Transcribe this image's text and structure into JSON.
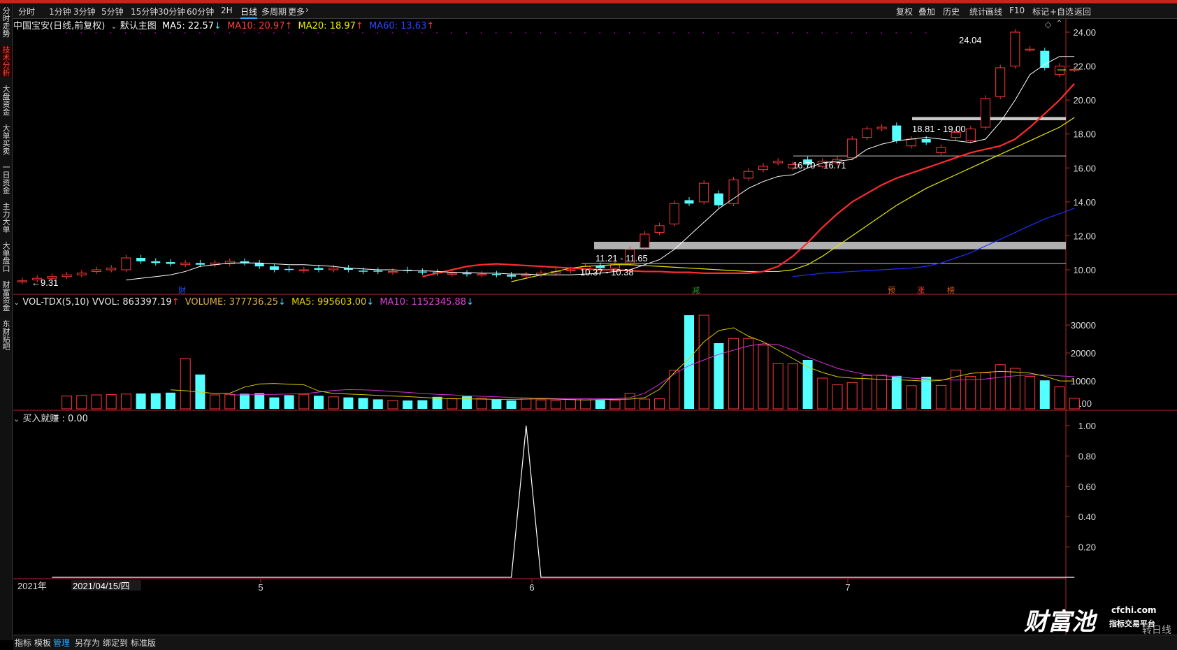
{
  "toolbar": {
    "left_items": [
      "分时",
      "1分钟",
      "3分钟",
      "5分钟",
      "15分钟",
      "30分钟",
      "60分钟",
      "2H",
      "日线",
      "多周期",
      "更多"
    ],
    "active": "日线",
    "right_items": [
      "复权",
      "叠加",
      "历史",
      "统计",
      "画线",
      "F10",
      "标记",
      "+自选",
      "返回"
    ]
  },
  "sidebar": {
    "items": [
      "分时走势",
      "技术分析",
      "大盘资金",
      "大单买卖",
      "一日资金",
      "主力大单",
      "大单盘口",
      "财富资金",
      "东财贴吧"
    ],
    "active": "技术分析"
  },
  "main": {
    "title": "中国宝安(日线,前复权)",
    "template": "默认主图",
    "ma5": "MA5: 22.57",
    "ma10": "MA10: 20.97",
    "ma20": "MA20: 18.97",
    "ma60": "MA60: 13.63",
    "colors": {
      "ma5": "#ffffff",
      "ma10": "#ff2b2b",
      "ma20": "#e6e600",
      "ma60": "#1a30ff"
    },
    "y_ticks": [
      "24.00",
      "22.00",
      "20.00",
      "18.00",
      "16.00",
      "14.00",
      "12.00",
      "10.00"
    ],
    "annotations": {
      "high": "24.04",
      "low": "9.31",
      "gap_a": "18.81 - 19.00",
      "gap_b": "16.70 - 16.71",
      "gap_c": "11.21 - 11.65",
      "gap_d": "10.37 - 10.38"
    },
    "markers": [
      "财",
      "减",
      "预",
      "涨",
      "榜"
    ]
  },
  "volume": {
    "title": "VOL-TDX(5,10)",
    "vvol": "VVOL: 863397.19",
    "volume": "VOLUME: 377736.25",
    "ma5": "MA5: 995603.00",
    "ma10": "MA10: 1152345.88",
    "y_ticks": [
      "30000",
      "20000",
      "10000"
    ],
    "unit": "X100"
  },
  "indicator": {
    "title": "买入就赚 : 0.00",
    "y_ticks": [
      "1.00",
      "0.80",
      "0.60",
      "0.40",
      "0.20"
    ]
  },
  "time_axis": {
    "year": "2021年",
    "cursor_date": "2021/04/15/四",
    "months": [
      "5",
      "6",
      "7"
    ]
  },
  "bottom_tabs": {
    "items": [
      "指标",
      "模板",
      "管理",
      "另存为",
      "绑定到",
      "标准版"
    ],
    "active": "管理"
  },
  "watermark": {
    "brand": "财富池",
    "site": "cfchi.com",
    "slogan": "指标交易平台",
    "right_text": "转日线"
  },
  "chart_data": [
    {
      "type": "candlestick",
      "title": "中国宝安(日线,前复权)",
      "note": "daily K-line from 2021-03 to 2021-08, prices in CNY",
      "ylim": [
        9.0,
        24.5
      ],
      "close": [
        9.35,
        9.5,
        9.6,
        9.7,
        9.8,
        10.0,
        10.1,
        10.7,
        10.5,
        10.4,
        10.35,
        10.4,
        10.3,
        10.4,
        10.5,
        10.4,
        10.2,
        10.0,
        10.0,
        10.0,
        10.0,
        10.1,
        10.0,
        9.9,
        9.9,
        9.9,
        9.95,
        9.85,
        9.8,
        9.8,
        9.75,
        9.75,
        9.7,
        9.6,
        9.7,
        9.8,
        9.9,
        10.0,
        10.2,
        10.1,
        10.3,
        11.2,
        12.1,
        12.6,
        13.9,
        13.9,
        15.1,
        13.8,
        15.3,
        15.8,
        16.1,
        16.4,
        16.2,
        16.2,
        16.4,
        16.5,
        17.7,
        18.3,
        18.4,
        17.6,
        17.7,
        17.5,
        17.2,
        18.1,
        18.3,
        20.1,
        21.9,
        24.0,
        23.0,
        21.9,
        22.0,
        21.8
      ],
      "open": [
        9.3,
        9.4,
        9.5,
        9.6,
        9.7,
        9.9,
        10.0,
        10.0,
        10.7,
        10.5,
        10.45,
        10.3,
        10.4,
        10.3,
        10.35,
        10.5,
        10.4,
        10.2,
        10.05,
        9.95,
        10.1,
        10.0,
        10.1,
        9.95,
        9.95,
        9.85,
        10.0,
        9.9,
        9.85,
        9.75,
        9.8,
        9.7,
        9.75,
        9.7,
        9.65,
        9.7,
        9.8,
        9.95,
        10.05,
        10.25,
        10.1,
        10.4,
        11.3,
        12.2,
        12.7,
        14.1,
        14.0,
        14.5,
        13.9,
        15.4,
        15.9,
        16.3,
        16.0,
        16.5,
        16.1,
        16.3,
        16.6,
        17.8,
        18.3,
        18.5,
        17.3,
        17.7,
        16.9,
        17.8,
        17.6,
        18.4,
        20.2,
        22.0,
        23.0,
        22.9,
        21.5,
        21.8
      ],
      "ma5": [
        9.4,
        9.5,
        9.6,
        9.7,
        9.9,
        10.2,
        10.3,
        10.4,
        10.4,
        10.4,
        10.35,
        10.3,
        10.3,
        10.25,
        10.2,
        10.1,
        10.05,
        10.0,
        10.0,
        9.95,
        9.95,
        9.9,
        9.85,
        9.85,
        9.8,
        9.8,
        9.75,
        9.75,
        9.7,
        9.7,
        9.7,
        9.75,
        9.8,
        9.9,
        10.0,
        10.3,
        10.6,
        11.2,
        12.0,
        12.8,
        13.6,
        14.2,
        14.8,
        15.2,
        15.5,
        15.6,
        16.0,
        16.3,
        16.4,
        16.5,
        17.1,
        17.4,
        17.6,
        17.7,
        17.8,
        17.7,
        17.6,
        17.5,
        17.7,
        18.7,
        20.0,
        21.5,
        22.1,
        22.57,
        22.57
      ],
      "ma10": [
        9.6,
        9.8,
        10.0,
        10.2,
        10.3,
        10.35,
        10.3,
        10.25,
        10.2,
        10.15,
        10.1,
        10.05,
        10.0,
        10.0,
        9.95,
        9.9,
        9.9,
        9.85,
        9.85,
        9.8,
        9.8,
        9.8,
        9.8,
        9.9,
        10.2,
        10.8,
        11.6,
        12.5,
        13.3,
        14.0,
        14.5,
        15.0,
        15.4,
        15.7,
        16.0,
        16.3,
        16.6,
        16.9,
        17.1,
        17.3,
        17.7,
        18.4,
        19.2,
        20.0,
        20.97
      ],
      "ma20": [
        9.3,
        9.5,
        9.7,
        9.9,
        10.1,
        10.2,
        10.25,
        10.3,
        10.3,
        10.25,
        10.2,
        10.15,
        10.1,
        10.05,
        10.0,
        9.95,
        9.9,
        9.9,
        9.9,
        10.0,
        10.3,
        10.8,
        11.4,
        12.0,
        12.6,
        13.2,
        13.8,
        14.3,
        14.8,
        15.2,
        15.6,
        16.0,
        16.4,
        16.8,
        17.2,
        17.6,
        18.0,
        18.4,
        18.97
      ],
      "ma60": [
        9.6,
        9.7,
        9.8,
        9.85,
        9.9,
        9.95,
        10.0,
        10.05,
        10.1,
        10.2,
        10.4,
        10.7,
        11.0,
        11.4,
        11.8,
        12.2,
        12.6,
        13.0,
        13.3,
        13.63
      ]
    },
    {
      "type": "bar",
      "title": "VOL-TDX(5,10)",
      "unit": "X100",
      "ylim": [
        0,
        35000
      ],
      "values": [
        4600,
        4800,
        5000,
        5100,
        5300,
        5500,
        5600,
        5800,
        18000,
        12300,
        5000,
        5200,
        5400,
        5600,
        4100,
        4900,
        5200,
        4700,
        4300,
        4100,
        3900,
        3400,
        3000,
        3000,
        3100,
        4300,
        3700,
        4500,
        3800,
        3500,
        3000,
        3900,
        3200,
        3000,
        3400,
        3600,
        3200,
        3100,
        5600,
        3500,
        3600,
        13800,
        33500,
        33500,
        23500,
        25200,
        25200,
        22800,
        16200,
        16100,
        17500,
        11000,
        8600,
        9400,
        11900,
        12100,
        11800,
        8300,
        11500,
        8400,
        13900,
        11600,
        12900,
        15800,
        14500,
        11600,
        10200,
        7900,
        3780
      ],
      "ma5": [
        6800,
        6500,
        6000,
        5500,
        5600,
        7800,
        8900,
        9100,
        8800,
        8600,
        6400,
        5500,
        5300,
        5100,
        4800,
        4600,
        4400,
        4100,
        3800,
        3600,
        3600,
        3500,
        3400,
        3400,
        3500,
        3600,
        3500,
        3300,
        3200,
        3300,
        3400,
        3500,
        4000,
        7000,
        13000,
        18000,
        24000,
        28000,
        29000,
        26000,
        24000,
        21000,
        18000,
        15000,
        13000,
        11500,
        11000,
        10800,
        10500,
        10400,
        10200,
        9900,
        10200,
        11500,
        12700,
        13100,
        13400,
        13200,
        12800,
        11700,
        10000,
        9956
      ],
      "ma10": [
        5000,
        5000,
        5100,
        5200,
        5300,
        5400,
        6000,
        6600,
        6900,
        6800,
        6600,
        6200,
        5900,
        5500,
        5200,
        5000,
        4700,
        4500,
        4300,
        4100,
        3900,
        3800,
        3700,
        3600,
        3600,
        3600,
        3700,
        4000,
        5600,
        8800,
        12500,
        15500,
        17500,
        19500,
        21000,
        22500,
        23300,
        23000,
        21000,
        18500,
        16500,
        14500,
        13300,
        12200,
        11900,
        11500,
        11000,
        10700,
        10400,
        10300,
        10400,
        10700,
        11300,
        11800,
        12200,
        12100,
        11800,
        11523
      ]
    },
    {
      "type": "line",
      "title": "买入就赚",
      "ylim": [
        0,
        1.0
      ],
      "values_note": "zero everywhere except a single spike",
      "spike_at": "2021-05-19",
      "values": [
        0,
        0,
        0,
        0,
        0,
        0,
        0,
        0,
        0,
        0,
        0,
        0,
        0,
        0,
        0,
        0,
        0,
        0,
        0,
        0,
        0,
        0,
        0,
        0,
        0,
        0,
        0,
        0,
        0,
        0,
        0,
        0,
        1,
        0,
        0,
        0,
        0,
        0,
        0,
        0,
        0,
        0,
        0,
        0,
        0,
        0,
        0,
        0,
        0,
        0,
        0,
        0,
        0,
        0,
        0,
        0,
        0,
        0,
        0,
        0,
        0,
        0,
        0,
        0,
        0,
        0,
        0,
        0,
        0,
        0
      ]
    }
  ]
}
